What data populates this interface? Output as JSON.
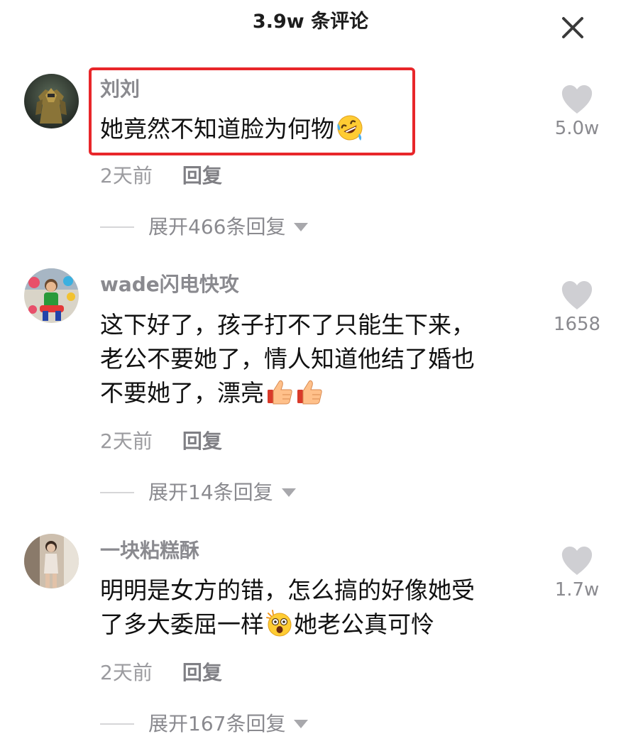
{
  "header": {
    "title": "3.9w 条评论",
    "close_icon": "close-icon"
  },
  "colors": {
    "highlight": "#e8262a",
    "username": "#8a8a8f",
    "like_icon": "#c8c8cc"
  },
  "comments": [
    {
      "username": "刘刘",
      "lines": [
        "她竟然不知道脸为何物"
      ],
      "emoji": "rolling-on-floor-laughing-emoji",
      "time": "2天前",
      "reply_label": "回复",
      "expand_label": "展开466条回复",
      "likes": "5.0w",
      "highlighted": true
    },
    {
      "username": "wade闪电快攻",
      "lines": [
        "这下好了，孩子打不了只能生下来，",
        "老公不要她了，情人知道他结了婚也",
        "不要她了，漂亮"
      ],
      "emoji": "thumbs-up-emoji",
      "time": "2天前",
      "reply_label": "回复",
      "expand_label": "展开14条回复",
      "likes": "1658",
      "highlighted": false
    },
    {
      "username": "一块粘糕酥",
      "lines": [
        "明明是女方的错，怎么搞的好像她受",
        "了多大委屈一样",
        "她老公真可怜"
      ],
      "emoji": "astonished-face-emoji",
      "time": "2天前",
      "reply_label": "回复",
      "expand_label": "展开167条回复",
      "likes": "1.7w",
      "highlighted": false
    }
  ]
}
